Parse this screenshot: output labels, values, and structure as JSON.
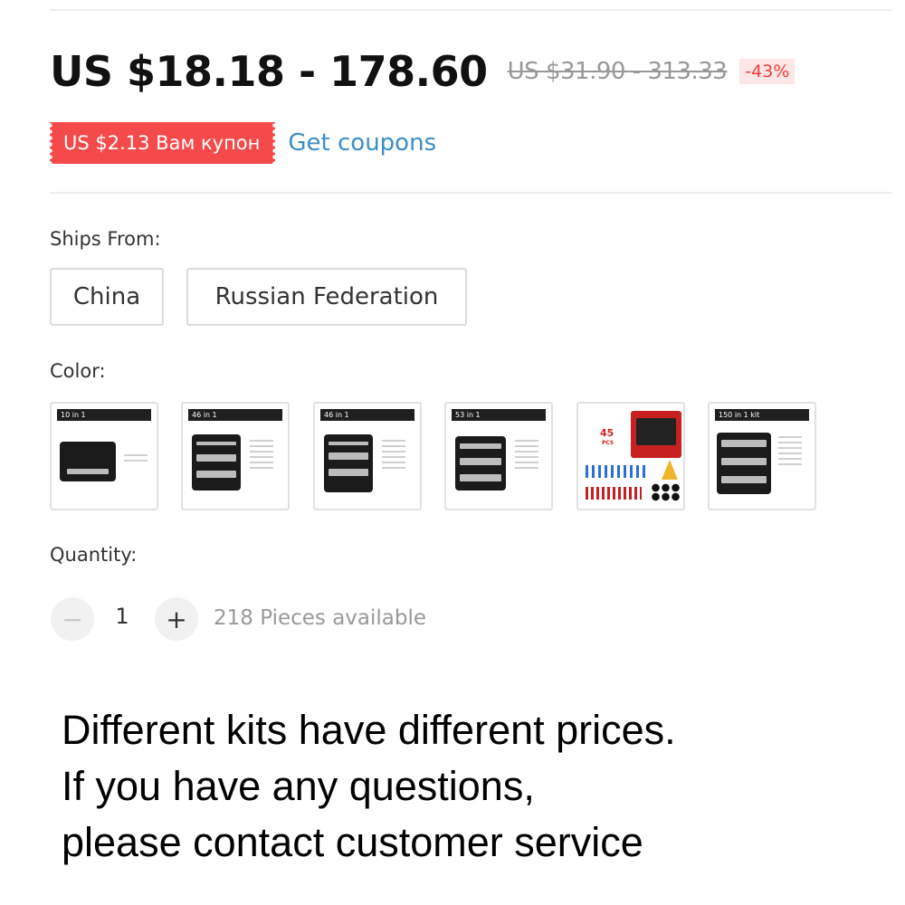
{
  "price": {
    "current": "US $18.18 - 178.60",
    "original": "US $31.90 - 313.33",
    "discount": "-43%"
  },
  "coupon": {
    "label": "US $2.13 Вам купон",
    "link": "Get coupons"
  },
  "ships_from": {
    "label": "Ships From:",
    "options": [
      "China",
      "Russian Federation"
    ]
  },
  "color": {
    "label": "Color:",
    "swatches": [
      {
        "header": "10 in 1"
      },
      {
        "header": "46 in 1"
      },
      {
        "header": "46 in 1"
      },
      {
        "header": "53 in 1"
      },
      {
        "badge": "45",
        "badge_sub": "PCS"
      },
      {
        "header": "150 in 1 kit"
      }
    ]
  },
  "quantity": {
    "label": "Quantity:",
    "value": "1",
    "available": "218 Pieces available",
    "minus_symbol": "−",
    "plus_symbol": "+"
  },
  "note": {
    "lines": [
      "Different kits have different prices.",
      "If you have any questions,",
      "please contact customer service"
    ]
  },
  "colors": {
    "coupon_bg": "#f44a4a",
    "discount_text": "#f03c3c",
    "link": "#3b8ec6"
  }
}
